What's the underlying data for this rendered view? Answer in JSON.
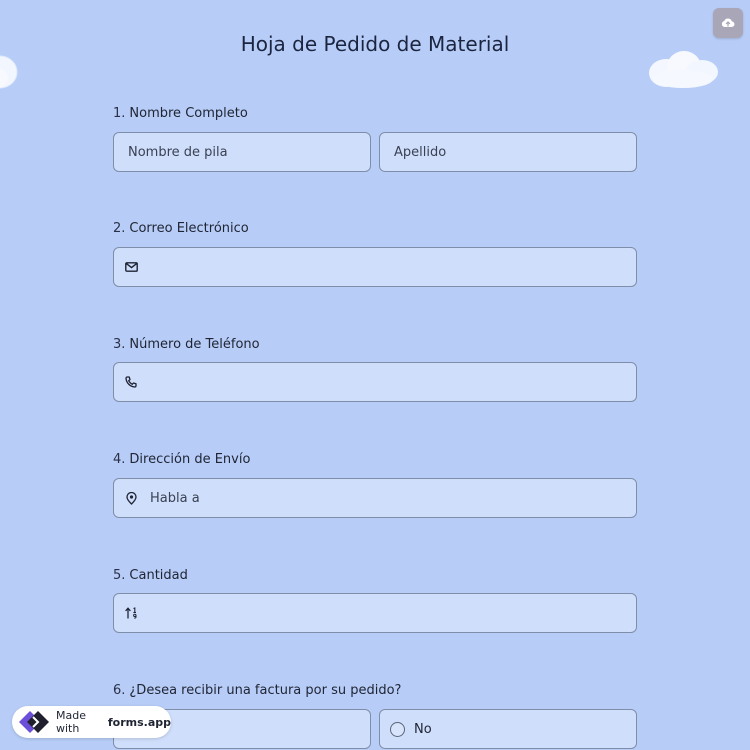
{
  "page": {
    "title": "Hoja de Pedido de Material",
    "background_color": "#b7cdf7",
    "field_color": "#cfdefb"
  },
  "upload_button": {
    "icon": "cloud-upload-icon"
  },
  "questions": [
    {
      "number": "1.",
      "label": "Nombre Completo",
      "fields": [
        {
          "placeholder": "Nombre de pila"
        },
        {
          "placeholder": "Apellido"
        }
      ]
    },
    {
      "number": "2.",
      "label": "Correo Electrónico",
      "icon": "mail-icon",
      "value": ""
    },
    {
      "number": "3.",
      "label": "Número de Teléfono",
      "icon": "phone-icon",
      "value": ""
    },
    {
      "number": "4.",
      "label": "Dirección de Envío",
      "icon": "location-pin-icon",
      "placeholder": "Habla a"
    },
    {
      "number": "5.",
      "label": "Cantidad",
      "icon": "number-sort-icon",
      "value": ""
    },
    {
      "number": "6.",
      "label": "¿Desea recibir una factura por su pedido?",
      "options": [
        {
          "label": ""
        },
        {
          "label": "No"
        }
      ]
    }
  ],
  "badge": {
    "prefix": "Made with",
    "brand": "forms.app",
    "icon": "forms-app-logo-icon"
  }
}
